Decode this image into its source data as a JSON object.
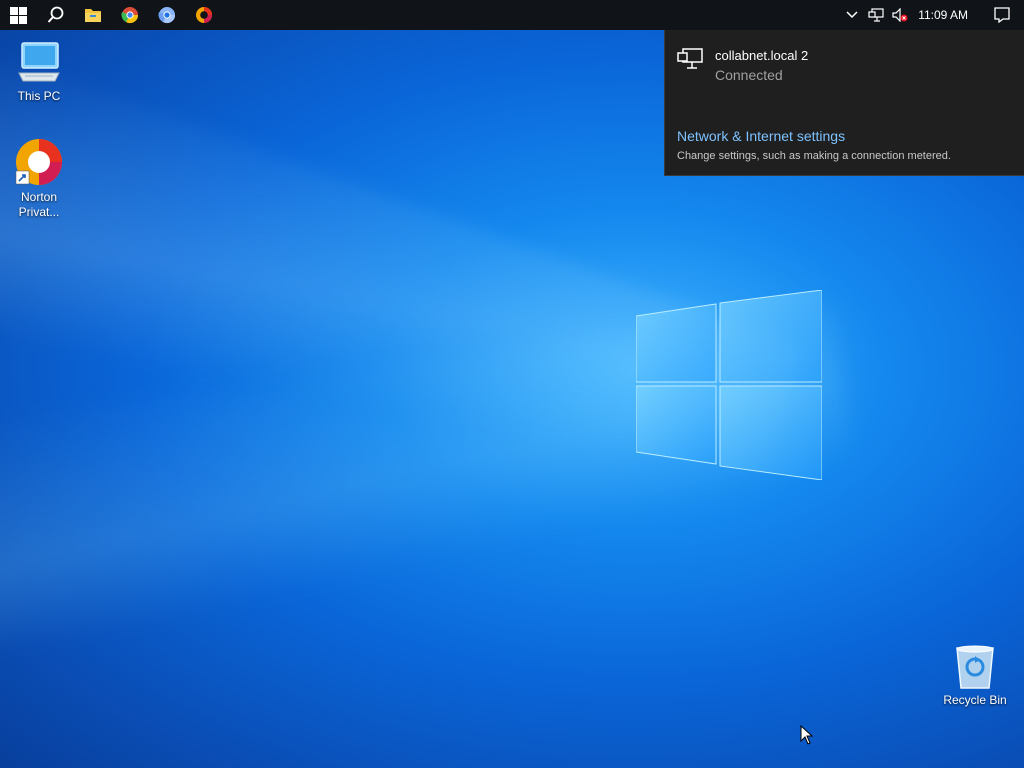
{
  "taskbar": {
    "pinned": [
      {
        "name": "start-button",
        "icon": "windows-logo-icon"
      },
      {
        "name": "search-button",
        "icon": "search-icon"
      },
      {
        "name": "file-explorer",
        "icon": "folder-icon"
      },
      {
        "name": "chrome",
        "icon": "chrome-icon"
      },
      {
        "name": "chromium",
        "icon": "chromium-icon"
      },
      {
        "name": "norton-private-browser",
        "icon": "norton-icon"
      }
    ],
    "tray": {
      "chevron": "chevron-up-icon",
      "network": "network-icon",
      "volume": "volume-muted-icon"
    },
    "clock": "11:09 AM"
  },
  "network_flyout": {
    "network_name": "collabnet.local 2",
    "status": "Connected",
    "settings_link": "Network & Internet settings",
    "settings_desc": "Change settings, such as making a connection metered."
  },
  "desktop": {
    "icons": [
      {
        "label": "This PC",
        "icon": "computer-icon"
      },
      {
        "label": "Norton\nPrivat...",
        "line1": "Norton",
        "line2": "Privat...",
        "icon": "norton-icon"
      },
      {
        "label": "Recycle Bin",
        "icon": "recycle-bin-icon"
      }
    ]
  },
  "colors": {
    "taskbar": "#101418",
    "flyout": "#1f1f1f",
    "link": "#7ec2ff",
    "accent": "#0a66d8"
  }
}
